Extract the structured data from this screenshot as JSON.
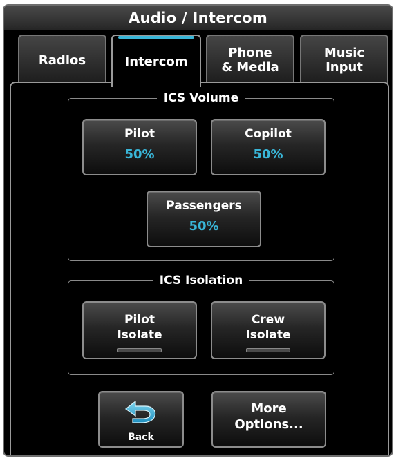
{
  "header": {
    "title": "Audio / Intercom"
  },
  "tabs": [
    {
      "label": "Radios",
      "active": false
    },
    {
      "label": "Intercom",
      "active": true
    },
    {
      "label": "Phone\n& Media",
      "active": false
    },
    {
      "label": "Music\nInput",
      "active": false
    }
  ],
  "ics_volume": {
    "title": "ICS Volume",
    "pilot": {
      "label": "Pilot",
      "value": "50%"
    },
    "copilot": {
      "label": "Copilot",
      "value": "50%"
    },
    "passengers": {
      "label": "Passengers",
      "value": "50%"
    }
  },
  "ics_isolation": {
    "title": "ICS Isolation",
    "pilot": {
      "label": "Pilot\nIsolate",
      "on": false
    },
    "crew": {
      "label": "Crew\nIsolate",
      "on": false
    }
  },
  "footer": {
    "back_label": "Back",
    "more_label": "More\nOptions..."
  },
  "colors": {
    "accent": "#39b6d8",
    "background": "#000000",
    "border": "#8c8c8c"
  },
  "icons": {
    "back": "back-arrow-icon"
  }
}
